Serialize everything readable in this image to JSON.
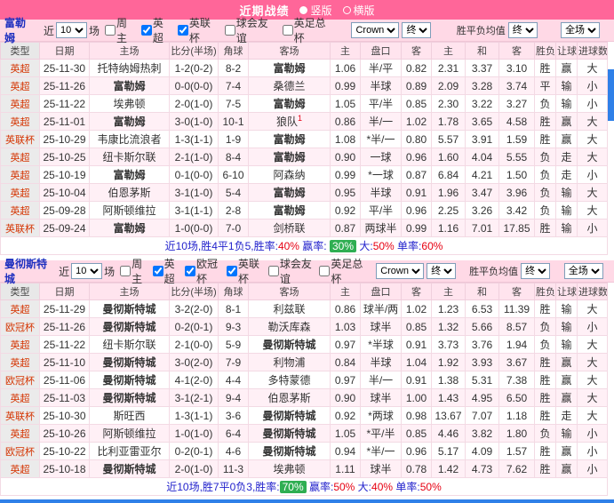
{
  "topbar": {
    "title": "近期战绩",
    "layout_options": [
      {
        "label": "竖版",
        "selected": true
      },
      {
        "label": "横版",
        "selected": false
      }
    ]
  },
  "columns": [
    "类型",
    "日期",
    "主场",
    "比分(半场)",
    "角球",
    "客场",
    "主",
    "盘口",
    "客",
    "主",
    "和",
    "客",
    "胜负",
    "让球",
    "进球数"
  ],
  "controls": {
    "recent_prefix": "近",
    "recent_count": "10",
    "recent_suffix": "场",
    "bookmaker": "Crown",
    "final1": "终",
    "avg_label": "胜平负均值",
    "final2": "终",
    "scope": "全场"
  },
  "tables": [
    {
      "team": "富勒姆",
      "filters": [
        {
          "label": "周主",
          "checked": false
        },
        {
          "label": "英超",
          "checked": true
        },
        {
          "label": "英联杯",
          "checked": true
        },
        {
          "label": "球会友谊",
          "checked": false
        },
        {
          "label": "英足总杯",
          "checked": false
        }
      ],
      "rows": [
        {
          "league": "英超",
          "date": "25-11-30",
          "home": "托特纳姆热刺",
          "score": "1-2(0-2)",
          "corners": "8-2",
          "away": "富勒姆",
          "o1": "1.06",
          "hcp": "半/平",
          "o2": "0.82",
          "a1": "2.31",
          "a2": "3.37",
          "a3": "3.10",
          "wl": "胜",
          "cover": "赢",
          "ou": "大"
        },
        {
          "league": "英超",
          "date": "25-11-26",
          "home": "富勒姆",
          "score": "0-0(0-0)",
          "corners": "7-4",
          "away": "桑德兰",
          "o1": "0.99",
          "hcp": "半球",
          "o2": "0.89",
          "a1": "2.09",
          "a2": "3.28",
          "a3": "3.74",
          "wl": "平",
          "cover": "输",
          "ou": "小"
        },
        {
          "league": "英超",
          "date": "25-11-22",
          "home": "埃弗顿",
          "score": "2-0(1-0)",
          "corners": "7-5",
          "away": "富勒姆",
          "o1": "1.05",
          "hcp": "平/半",
          "o2": "0.85",
          "a1": "2.30",
          "a2": "3.22",
          "a3": "3.27",
          "wl": "负",
          "cover": "输",
          "ou": "小"
        },
        {
          "league": "英超",
          "date": "25-11-01",
          "home": "富勒姆",
          "score": "3-0(1-0)",
          "corners": "10-1",
          "away": "狼队",
          "away_sup": "1",
          "o1": "0.86",
          "hcp": "半/一",
          "o2": "1.02",
          "a1": "1.78",
          "a2": "3.65",
          "a3": "4.58",
          "wl": "胜",
          "cover": "赢",
          "ou": "大"
        },
        {
          "league": "英联杯",
          "date": "25-10-29",
          "home": "韦康比流浪者",
          "score": "1-3(1-1)",
          "corners": "1-9",
          "away": "富勒姆",
          "o1": "1.08",
          "hcp": "*半/一",
          "o2": "0.80",
          "a1": "5.57",
          "a2": "3.91",
          "a3": "1.59",
          "wl": "胜",
          "cover": "赢",
          "ou": "大"
        },
        {
          "league": "英超",
          "date": "25-10-25",
          "home": "纽卡斯尔联",
          "score": "2-1(1-0)",
          "corners": "8-4",
          "away": "富勒姆",
          "o1": "0.90",
          "hcp": "一球",
          "o2": "0.96",
          "a1": "1.60",
          "a2": "4.04",
          "a3": "5.55",
          "wl": "负",
          "cover": "走",
          "ou": "大"
        },
        {
          "league": "英超",
          "date": "25-10-19",
          "home": "富勒姆",
          "score": "0-1(0-0)",
          "corners": "6-10",
          "away": "阿森纳",
          "o1": "0.99",
          "hcp": "*一球",
          "o2": "0.87",
          "a1": "6.84",
          "a2": "4.21",
          "a3": "1.50",
          "wl": "负",
          "cover": "走",
          "ou": "小"
        },
        {
          "league": "英超",
          "date": "25-10-04",
          "home": "伯恩茅斯",
          "score": "3-1(1-0)",
          "corners": "5-4",
          "away": "富勒姆",
          "o1": "0.95",
          "hcp": "半球",
          "o2": "0.91",
          "a1": "1.96",
          "a2": "3.47",
          "a3": "3.96",
          "wl": "负",
          "cover": "输",
          "ou": "大"
        },
        {
          "league": "英超",
          "date": "25-09-28",
          "home": "阿斯顿维拉",
          "score": "3-1(1-1)",
          "corners": "2-8",
          "away": "富勒姆",
          "o1": "0.92",
          "hcp": "平/半",
          "o2": "0.96",
          "a1": "2.25",
          "a2": "3.26",
          "a3": "3.42",
          "wl": "负",
          "cover": "输",
          "ou": "大"
        },
        {
          "league": "英联杯",
          "date": "25-09-24",
          "home": "富勒姆",
          "score": "1-0(0-0)",
          "corners": "7-0",
          "away": "剑桥联",
          "o1": "0.87",
          "hcp": "两球半",
          "o2": "0.99",
          "a1": "1.16",
          "a2": "7.01",
          "a3": "17.85",
          "wl": "胜",
          "cover": "输",
          "ou": "小"
        }
      ],
      "summary": [
        {
          "t": "近10场,胜4平1负5,胜率:",
          "c": "t"
        },
        {
          "t": "40%",
          "c": "r"
        },
        {
          "t": " 赢率: ",
          "c": "t"
        },
        {
          "t": "30%",
          "c": "badge"
        },
        {
          "t": " 大:",
          "c": "t"
        },
        {
          "t": "50%",
          "c": "r"
        },
        {
          "t": " 单率:",
          "c": "t"
        },
        {
          "t": "60%",
          "c": "r"
        }
      ]
    },
    {
      "team": "曼彻斯特城",
      "filters": [
        {
          "label": "周主",
          "checked": false
        },
        {
          "label": "英超",
          "checked": true
        },
        {
          "label": "欧冠杯",
          "checked": true
        },
        {
          "label": "英联杯",
          "checked": true
        },
        {
          "label": "球会友谊",
          "checked": false
        },
        {
          "label": "英足总杯",
          "checked": false
        }
      ],
      "rows": [
        {
          "league": "英超",
          "date": "25-11-29",
          "home": "曼彻斯特城",
          "score": "3-2(2-0)",
          "corners": "8-1",
          "away": "利兹联",
          "o1": "0.86",
          "hcp": "球半/两",
          "o2": "1.02",
          "a1": "1.23",
          "a2": "6.53",
          "a3": "11.39",
          "wl": "胜",
          "cover": "输",
          "ou": "大"
        },
        {
          "league": "欧冠杯",
          "date": "25-11-26",
          "home": "曼彻斯特城",
          "score": "0-2(0-1)",
          "corners": "9-3",
          "away": "勒沃库森",
          "o1": "1.03",
          "hcp": "球半",
          "o2": "0.85",
          "a1": "1.32",
          "a2": "5.66",
          "a3": "8.57",
          "wl": "负",
          "cover": "输",
          "ou": "小"
        },
        {
          "league": "英超",
          "date": "25-11-22",
          "home": "纽卡斯尔联",
          "score": "2-1(0-0)",
          "corners": "5-9",
          "away": "曼彻斯特城",
          "o1": "0.97",
          "hcp": "*半球",
          "o2": "0.91",
          "a1": "3.73",
          "a2": "3.76",
          "a3": "1.94",
          "wl": "负",
          "cover": "输",
          "ou": "大"
        },
        {
          "league": "英超",
          "date": "25-11-10",
          "home": "曼彻斯特城",
          "score": "3-0(2-0)",
          "corners": "7-9",
          "away": "利物浦",
          "o1": "0.84",
          "hcp": "半球",
          "o2": "1.04",
          "a1": "1.92",
          "a2": "3.93",
          "a3": "3.67",
          "wl": "胜",
          "cover": "赢",
          "ou": "大"
        },
        {
          "league": "欧冠杯",
          "date": "25-11-06",
          "home": "曼彻斯特城",
          "score": "4-1(2-0)",
          "corners": "4-4",
          "away": "多特蒙德",
          "o1": "0.97",
          "hcp": "半/一",
          "o2": "0.91",
          "a1": "1.38",
          "a2": "5.31",
          "a3": "7.38",
          "wl": "胜",
          "cover": "赢",
          "ou": "大"
        },
        {
          "league": "英超",
          "date": "25-11-03",
          "home": "曼彻斯特城",
          "score": "3-1(2-1)",
          "corners": "9-4",
          "away": "伯恩茅斯",
          "o1": "0.90",
          "hcp": "球半",
          "o2": "1.00",
          "a1": "1.43",
          "a2": "4.95",
          "a3": "6.50",
          "wl": "胜",
          "cover": "赢",
          "ou": "大"
        },
        {
          "league": "英联杯",
          "date": "25-10-30",
          "home": "斯旺西",
          "score": "1-3(1-1)",
          "corners": "3-6",
          "away": "曼彻斯特城",
          "o1": "0.92",
          "hcp": "*两球",
          "o2": "0.98",
          "a1": "13.67",
          "a2": "7.07",
          "a3": "1.18",
          "wl": "胜",
          "cover": "走",
          "ou": "大"
        },
        {
          "league": "英超",
          "date": "25-10-26",
          "home": "阿斯顿维拉",
          "score": "1-0(1-0)",
          "corners": "6-4",
          "away": "曼彻斯特城",
          "o1": "1.05",
          "hcp": "*平/半",
          "o2": "0.85",
          "a1": "4.46",
          "a2": "3.82",
          "a3": "1.80",
          "wl": "负",
          "cover": "输",
          "ou": "小"
        },
        {
          "league": "欧冠杯",
          "date": "25-10-22",
          "home": "比利亚雷亚尔",
          "score": "0-2(0-1)",
          "corners": "4-6",
          "away": "曼彻斯特城",
          "o1": "0.94",
          "hcp": "*半/一",
          "o2": "0.96",
          "a1": "5.17",
          "a2": "4.09",
          "a3": "1.57",
          "wl": "胜",
          "cover": "赢",
          "ou": "小"
        },
        {
          "league": "英超",
          "date": "25-10-18",
          "home": "曼彻斯特城",
          "score": "2-0(1-0)",
          "corners": "11-3",
          "away": "埃弗顿",
          "o1": "1.11",
          "hcp": "球半",
          "o2": "0.78",
          "a1": "1.42",
          "a2": "4.73",
          "a3": "7.62",
          "wl": "胜",
          "cover": "赢",
          "ou": "小"
        }
      ],
      "summary": [
        {
          "t": "近10场,胜7平0负3,胜率:",
          "c": "t"
        },
        {
          "t": "70%",
          "c": "badge"
        },
        {
          "t": " 赢率:",
          "c": "t"
        },
        {
          "t": "50%",
          "c": "r"
        },
        {
          "t": " 大:",
          "c": "t"
        },
        {
          "t": "40%",
          "c": "r"
        },
        {
          "t": " 单率:",
          "c": "t"
        },
        {
          "t": "50%",
          "c": "r"
        }
      ]
    }
  ]
}
